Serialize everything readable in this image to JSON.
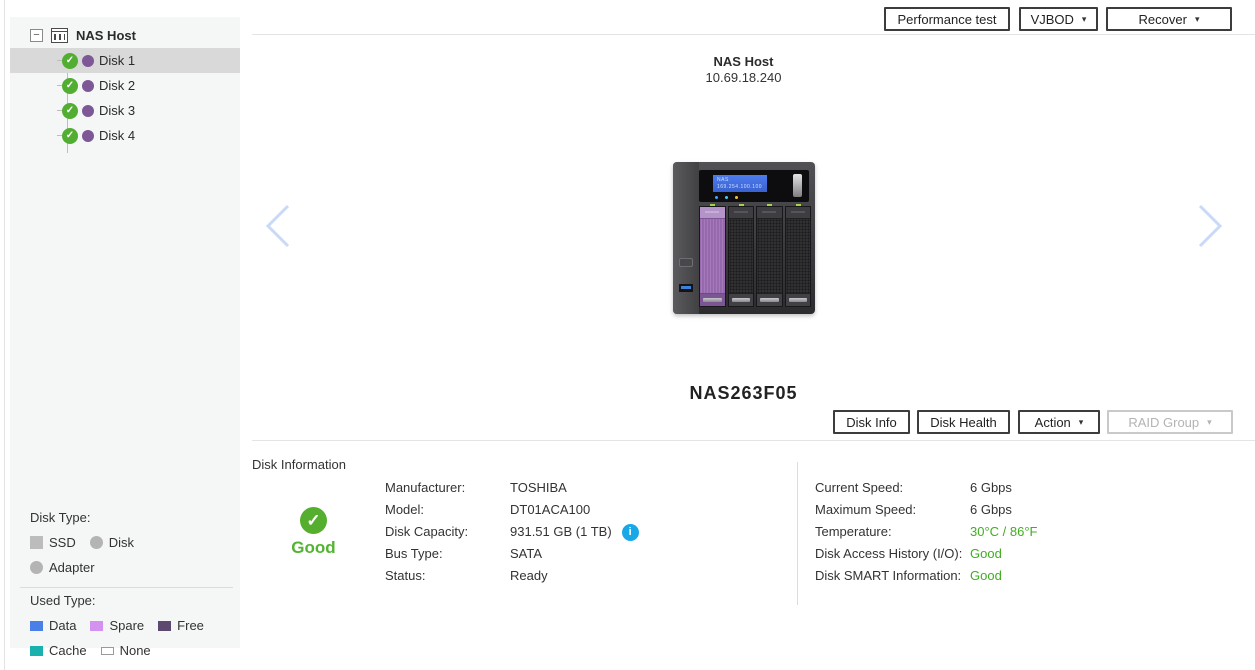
{
  "icons": {
    "collapse": "−",
    "check": "✓",
    "caret": "▾",
    "info": "i"
  },
  "colors": {
    "status_green": "#3eaf1e",
    "health_green": "#53b332",
    "check_green": "#52ae32",
    "info_blue": "#18a8e8",
    "selected_row": "#d9d9d9",
    "disk_dot_purple": "#7d5796",
    "chevron_blue": "#c9daf8",
    "legend_data": "#4a7fe8",
    "legend_spare": "#d392f0",
    "legend_free": "#5d4870",
    "legend_cache": "#18b1ad",
    "legend_none": "#ffffff"
  },
  "sidebar": {
    "tree": {
      "root_label": "NAS Host",
      "disks": [
        {
          "label": "Disk 1",
          "selected": true
        },
        {
          "label": "Disk 2",
          "selected": false
        },
        {
          "label": "Disk 3",
          "selected": false
        },
        {
          "label": "Disk 4",
          "selected": false
        }
      ]
    },
    "legend": {
      "disk_type_title": "Disk Type:",
      "disk_type": [
        {
          "label": "SSD"
        },
        {
          "label": "Disk"
        },
        {
          "label": "Adapter"
        }
      ],
      "used_type_title": "Used Type:",
      "used_type": [
        {
          "label": "Data"
        },
        {
          "label": "Spare"
        },
        {
          "label": "Free"
        },
        {
          "label": "Cache"
        },
        {
          "label": "None"
        }
      ]
    }
  },
  "toolbar": {
    "performance_test": "Performance test",
    "vjbod": "VJBOD",
    "recover": "Recover"
  },
  "host": {
    "name": "NAS Host",
    "ip": "10.69.18.240",
    "model": "NAS263F05"
  },
  "device": {
    "lcd_line1": "NAS",
    "lcd_line2": "169.254.100.100"
  },
  "actions": {
    "disk_info": "Disk Info",
    "disk_health": "Disk Health",
    "action": "Action",
    "raid_group": "RAID Group"
  },
  "disk_information": {
    "title": "Disk Information",
    "health_status": "Good",
    "fields_left": [
      {
        "label": "Manufacturer:",
        "value": "TOSHIBA"
      },
      {
        "label": "Model:",
        "value": "DT01ACA100"
      },
      {
        "label": "Disk Capacity:",
        "value": "931.51 GB (1 TB)"
      },
      {
        "label": "Bus Type:",
        "value": "SATA"
      },
      {
        "label": "Status:",
        "value": "Ready"
      }
    ],
    "fields_right": [
      {
        "label": "Current Speed:",
        "value": "6 Gbps"
      },
      {
        "label": "Maximum Speed:",
        "value": "6 Gbps"
      },
      {
        "label": "Temperature:",
        "value": "30°C / 86°F"
      },
      {
        "label": "Disk Access History (I/O):",
        "value": "Good"
      },
      {
        "label": "Disk SMART Information:",
        "value": "Good"
      }
    ]
  }
}
